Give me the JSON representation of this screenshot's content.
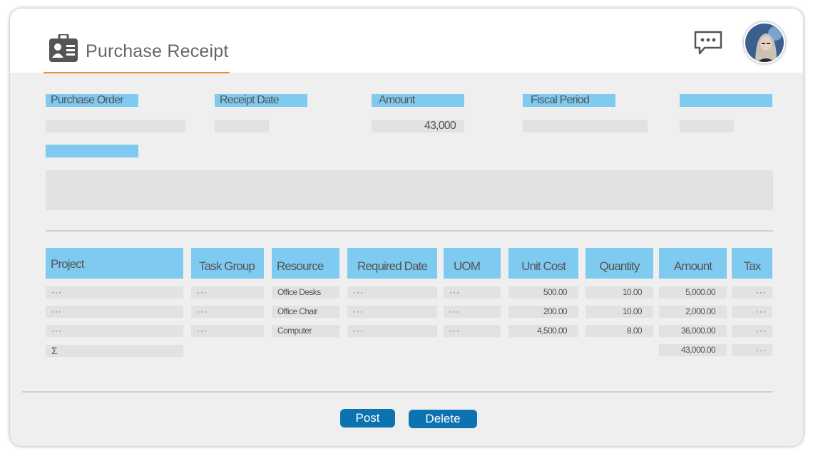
{
  "header": {
    "title": "Purchase Receipt",
    "title_icon": "id-card-icon",
    "chat_icon": "chat-bubble-icon",
    "avatar_icon": "user-avatar"
  },
  "form": {
    "labels": [
      "Purchase Order",
      "Receipt Date",
      "Amount",
      "Fiscal Period",
      "",
      ""
    ],
    "values": {
      "purchase_order": "",
      "receipt_date": "",
      "amount": "43,000",
      "fiscal_period": "",
      "field5": "",
      "notes": ""
    }
  },
  "table": {
    "headers": [
      "Project",
      "Task Group",
      "Resource",
      "Required Date",
      "UOM",
      "Unit Cost",
      "Quantity",
      "Amount",
      "Tax"
    ],
    "rows": [
      {
        "project": "···",
        "task_group": "···",
        "resource": "Office Desks",
        "required_date": "···",
        "uom": "···",
        "unit_cost": "500.00",
        "quantity": "10.00",
        "amount": "5,000.00",
        "tax": "···"
      },
      {
        "project": "···",
        "task_group": "···",
        "resource": "Office Chair",
        "required_date": "···",
        "uom": "···",
        "unit_cost": "200.00",
        "quantity": "10.00",
        "amount": "2,000.00",
        "tax": "···"
      },
      {
        "project": "···",
        "task_group": "···",
        "resource": "Computer",
        "required_date": "···",
        "uom": "···",
        "unit_cost": "4,500.00",
        "quantity": "8.00",
        "amount": "36,000.00",
        "tax": "···"
      }
    ],
    "total": {
      "symbol": "Σ",
      "amount": "43,000.00",
      "tax": "···"
    }
  },
  "actions": {
    "post_label": "Post",
    "delete_label": "Delete"
  },
  "colors": {
    "accent": "#e8913c",
    "label_bg": "#7fcaf0",
    "button": "#0d72b0",
    "field_bg": "#e2e2e2"
  }
}
